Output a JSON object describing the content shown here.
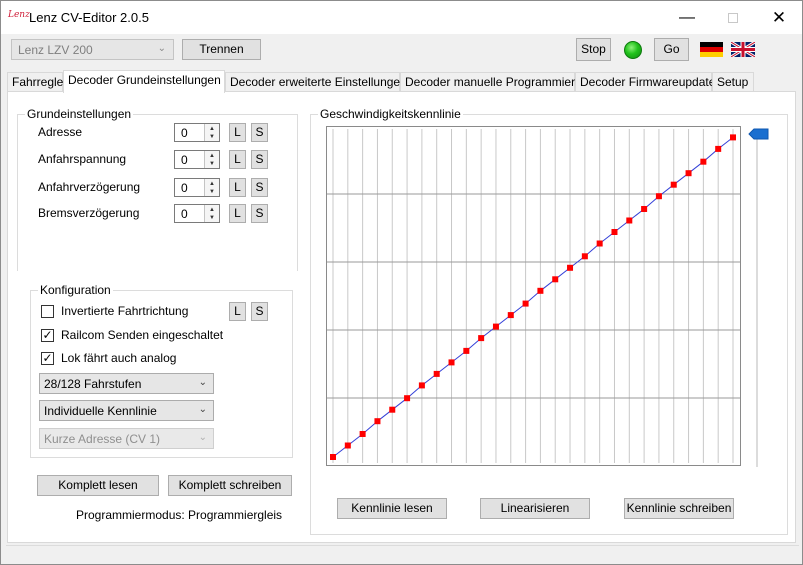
{
  "window": {
    "title": "Lenz CV-Editor 2.0.5",
    "icon_text": "Lenz",
    "minimize_icon": "minimize-icon",
    "maximize_icon": "maximize-icon",
    "close_icon": "close-icon"
  },
  "toolbar": {
    "interface_value": "Lenz LZV 200",
    "disconnect_label": "Trennen",
    "stop_label": "Stop",
    "go_label": "Go",
    "status_color": "#22c21d"
  },
  "tabs": [
    {
      "label": "Fahrregler"
    },
    {
      "label": "Decoder Grundeinstellungen"
    },
    {
      "label": "Decoder erweiterte Einstellungen"
    },
    {
      "label": "Decoder manuelle Programmierung"
    },
    {
      "label": "Decoder Firmwareupdate"
    },
    {
      "label": "Setup"
    }
  ],
  "basic": {
    "title": "Grundeinstellungen",
    "rows": [
      {
        "label": "Adresse",
        "value": "0",
        "read": "L",
        "write": "S"
      },
      {
        "label": "Anfahrspannung",
        "value": "0",
        "read": "L",
        "write": "S"
      },
      {
        "label": "Anfahrverzögerung",
        "value": "0",
        "read": "L",
        "write": "S"
      },
      {
        "label": "Bremsverzögerung",
        "value": "0",
        "read": "L",
        "write": "S"
      }
    ]
  },
  "config": {
    "title": "Konfiguration",
    "checkboxes": [
      {
        "label": "Invertierte Fahrtrichtung",
        "checked": false
      },
      {
        "label": "Railcom Senden eingeschaltet",
        "checked": true
      },
      {
        "label": "Lok fährt auch analog",
        "checked": true
      }
    ],
    "read": "L",
    "write": "S",
    "speed_steps": "28/128 Fahrstufen",
    "curve_mode": "Individuelle Kennlinie",
    "address_mode": "Kurze Adresse (CV 1)"
  },
  "actions": {
    "read_all": "Komplett lesen",
    "write_all": "Komplett schreiben",
    "mode_text": "Programmiermodus: Programmiergleis"
  },
  "curve": {
    "title": "Geschwindigkeitskennlinie",
    "read_label": "Kennlinie lesen",
    "linearize_label": "Linearisieren",
    "write_label": "Kennlinie schreiben",
    "line_color": "#3340d8",
    "point_color": "#ff0000",
    "slider_color": "#1a6fd0"
  },
  "chart_data": {
    "type": "line",
    "title": "Geschwindigkeitskennlinie",
    "x": [
      1,
      2,
      3,
      4,
      5,
      6,
      7,
      8,
      9,
      10,
      11,
      12,
      13,
      14,
      15,
      16,
      17,
      18,
      19,
      20,
      21,
      22,
      23,
      24,
      25,
      26,
      27,
      28
    ],
    "y": [
      0,
      9,
      18,
      28,
      37,
      46,
      56,
      65,
      74,
      83,
      93,
      102,
      111,
      120,
      130,
      139,
      148,
      157,
      167,
      176,
      185,
      194,
      204,
      213,
      222,
      231,
      241,
      250
    ],
    "ylim": [
      0,
      255
    ],
    "grid": true
  }
}
